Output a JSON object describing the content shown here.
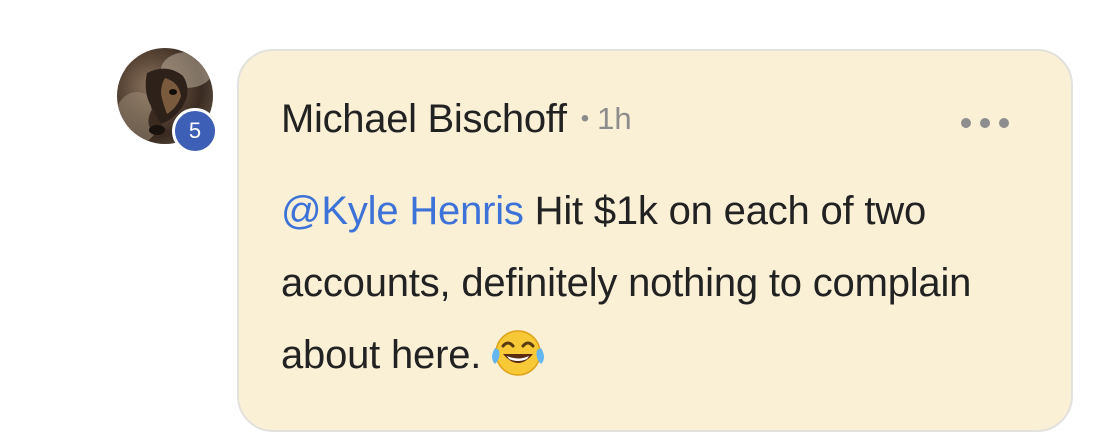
{
  "author": {
    "name": "Michael Bischoff",
    "level_badge": "5",
    "avatar_icon": "dog-avatar-photo"
  },
  "comment": {
    "separator": "•",
    "timestamp": "1h",
    "mention": "@Kyle Henris",
    "text": " Hit $1k on each of two accounts, definitely nothing to complain about here.",
    "emoji_icon": "face-with-tears-of-joy-icon",
    "more_icon": "more-options-icon"
  },
  "colors": {
    "bubble_background": "#faf0d6",
    "bubble_border": "#e3e1dc",
    "badge_background": "#3d5fb5",
    "mention_color": "#3d72d8",
    "text_color": "#222222",
    "muted_color": "#8c8c8c"
  }
}
